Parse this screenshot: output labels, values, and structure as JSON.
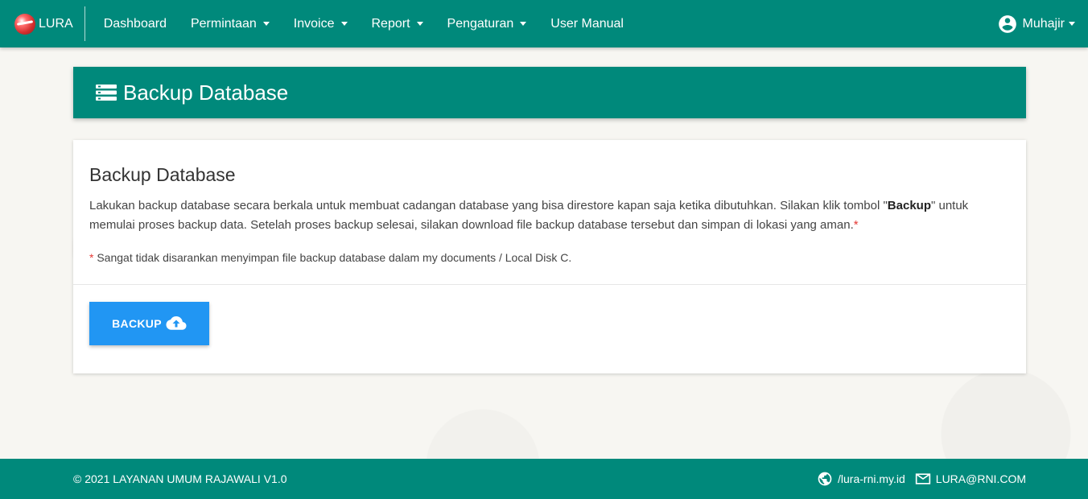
{
  "navbar": {
    "brand": "LURA",
    "items": [
      {
        "label": "Dashboard",
        "dropdown": false
      },
      {
        "label": "Permintaan",
        "dropdown": true
      },
      {
        "label": "Invoice",
        "dropdown": true
      },
      {
        "label": "Report",
        "dropdown": true
      },
      {
        "label": "Pengaturan",
        "dropdown": true
      },
      {
        "label": "User Manual",
        "dropdown": false
      }
    ],
    "user": "Muhajir"
  },
  "header": {
    "title": "Backup Database",
    "icon": "list-icon"
  },
  "card": {
    "title": "Backup Database",
    "desc_part1": "Lakukan backup database secara berkala untuk membuat cadangan database yang bisa direstore kapan saja ketika dibutuhkan. Silakan klik tombol \"",
    "desc_bold": "Backup",
    "desc_part2": "\" untuk memulai proses backup data. Setelah proses backup selesai, silakan download file backup database tersebut dan simpan di lokasi yang aman.",
    "asterisk": "*",
    "note": " Sangat tidak disarankan menyimpan file backup database dalam my documents / Local Disk C.",
    "button_label": "BACKUP",
    "button_icon": "cloud-upload-icon"
  },
  "footer": {
    "copyright": "© 2021 LAYANAN UMUM RAJAWALI V1.0",
    "website": "/lura-rni.my.id",
    "email": "LURA@RNI.COM"
  },
  "colors": {
    "primary": "#00897b",
    "button": "#2196f3",
    "asterisk": "#e53935"
  }
}
